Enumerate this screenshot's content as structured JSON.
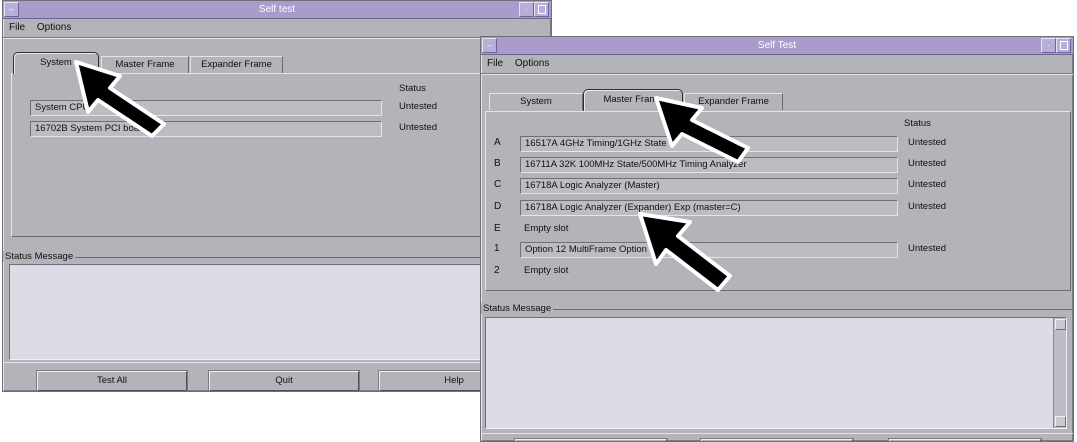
{
  "win1": {
    "title": "Self test",
    "menu": [
      "File",
      "Options"
    ],
    "tabs": [
      "System",
      "Master Frame",
      "Expander Frame"
    ],
    "status_header": "Status",
    "rows": [
      {
        "label": "System CPU",
        "status": "Untested"
      },
      {
        "label": "16702B System PCI board",
        "status": "Untested"
      }
    ],
    "status_message_label": "Status Message",
    "buttons": [
      "Test All",
      "Quit",
      "Help"
    ]
  },
  "win2": {
    "title": "Self Test",
    "menu": [
      "File",
      "Options"
    ],
    "tabs": [
      "System",
      "Master Frame",
      "Expander Frame"
    ],
    "status_header": "Status",
    "rows": [
      {
        "slot": "A",
        "label": "16517A 4GHz Timing/1GHz State",
        "status": "Untested",
        "boxed": true
      },
      {
        "slot": "B",
        "label": "16711A 32K 100MHz State/500MHz Timing Analyzer",
        "status": "Untested",
        "boxed": true
      },
      {
        "slot": "C",
        "label": "16718A Logic Analyzer (Master)",
        "status": "Untested",
        "boxed": true
      },
      {
        "slot": "D",
        "label": "16718A Logic Analyzer (Expander) Exp (master=C)",
        "status": "Untested",
        "boxed": true
      },
      {
        "slot": "E",
        "label": "Empty slot",
        "status": "",
        "boxed": false
      },
      {
        "slot": "1",
        "label": "Option 12 MultiFrame Option",
        "status": "Untested",
        "boxed": true
      },
      {
        "slot": "2",
        "label": "Empty slot",
        "status": "",
        "boxed": false
      }
    ],
    "status_message_label": "Status Message"
  },
  "colors": {
    "titlebar": "#a99ccc",
    "window_bg": "#b3b3ba",
    "message_area": "#dcdce6",
    "cursor": "#000000"
  },
  "icons": [
    "window-menu-icon",
    "minimize-icon",
    "maximize-icon",
    "arrow-cursor-icon"
  ]
}
